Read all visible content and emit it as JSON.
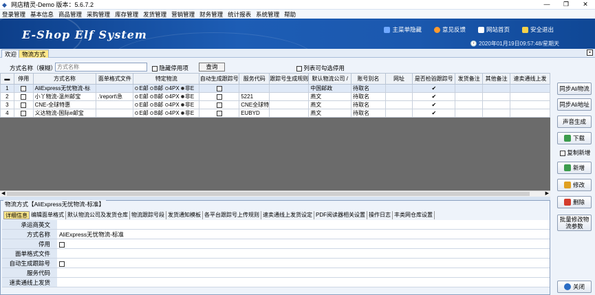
{
  "window": {
    "title": "网店精灵-Demo 版本：5.6.7.2",
    "minimize": "—",
    "restore": "❐",
    "close": "✕"
  },
  "menu": [
    "登录管理",
    "基本信息",
    "商品管理",
    "采购管理",
    "库存管理",
    "发货管理",
    "营销管理",
    "财务管理",
    "统计报表",
    "系统管理",
    "帮助"
  ],
  "banner": {
    "logo": "E-Shop Elf System",
    "links": [
      {
        "label": "主菜单隐藏",
        "icon": "menu-icon",
        "color": "#6fa8ff"
      },
      {
        "label": "意见反馈",
        "icon": "feedback-icon",
        "color": "#ff9a2e"
      },
      {
        "label": "网站首页",
        "icon": "home-icon",
        "color": "#ffffff"
      },
      {
        "label": "安全退出",
        "icon": "lock-icon",
        "color": "#f7d24a"
      }
    ],
    "datetime": "2020年01月19日09:57:48/星期天"
  },
  "tabs": [
    "欢迎",
    "物流方式"
  ],
  "search": {
    "label": "方式名称（模糊）",
    "placeholder": "方式名称",
    "hide_disabled": "隐藏停用项",
    "query_button": "查询",
    "list_optional": "列表可勾选停用"
  },
  "grid": {
    "columns": [
      "",
      "停用",
      "方式名称",
      "面单格式文件",
      "特定物流",
      "自动生成跟踪号",
      "服务代码",
      "跟踪号生成规则",
      "默认物流公司 /",
      "账号别名",
      "网址",
      "是否检验跟踪号",
      "发货备注",
      "其他备注",
      "速卖通线上发"
    ],
    "rows": [
      {
        "num": "1",
        "name": "AliExpress无忧物流-标",
        "file": "",
        "code": "",
        "company": "中国邮政",
        "account": "待取名",
        "verify": true
      },
      {
        "num": "2",
        "name": "小丫物流-温州邮宝",
        "file": ".\\report\\急",
        "code": "5221",
        "company": "燕文",
        "account": "待取名",
        "verify": true
      },
      {
        "num": "3",
        "name": "CNE-全球特惠",
        "file": "",
        "code": "CNE全球特",
        "company": "燕文",
        "account": "待取名",
        "verify": true
      },
      {
        "num": "4",
        "name": "义达物流-国际e邮宝",
        "file": "",
        "code": "EUBYD",
        "company": "燕文",
        "account": "待取名",
        "verify": true
      }
    ],
    "radio_labels": [
      "E邮",
      "B邮",
      "4PX",
      "非E"
    ]
  },
  "right_buttons": [
    {
      "label": "同步Ali物流",
      "icon": ""
    },
    {
      "label": "同步Ali地址",
      "icon": ""
    },
    {
      "label": "声音生成",
      "icon": ""
    },
    {
      "label": "下载",
      "icon": "download-icon"
    },
    {
      "label": "复制新增",
      "icon": "checkbox"
    },
    {
      "label": "新增",
      "icon": "add-icon"
    },
    {
      "label": "修改",
      "icon": "edit-icon"
    },
    {
      "label": "删除",
      "icon": "delete-icon"
    },
    {
      "label": "批量修改物流参数",
      "icon": ""
    },
    {
      "label": "关闭",
      "icon": "power-icon"
    }
  ],
  "detail": {
    "title": "物流方式【AliExpress无忧物流-标准】",
    "tabs": [
      "详细信息",
      "编辑面单格式",
      "默认物流公司及发货仓库",
      "物流跟踪号段",
      "发货通知模板",
      "各平台跟踪号上传规则",
      "速卖通线上发货设定",
      "PDF阅读器相关设置",
      "操作日志",
      "丰类网仓库设置"
    ],
    "fields": [
      {
        "label": "承运商英文",
        "value": "",
        "checkbox": false
      },
      {
        "label": "方式名称",
        "value": "AliExpress无忧物流-标准",
        "checkbox": false
      },
      {
        "label": "停用",
        "value": "",
        "checkbox": true
      },
      {
        "label": "面单格式文件",
        "value": "",
        "checkbox": false
      },
      {
        "label": "自动生成跟踪号",
        "value": "",
        "checkbox": true
      },
      {
        "label": "服务代码",
        "value": "",
        "checkbox": false
      },
      {
        "label": "速卖通线上发货",
        "value": "",
        "checkbox": false
      }
    ]
  }
}
